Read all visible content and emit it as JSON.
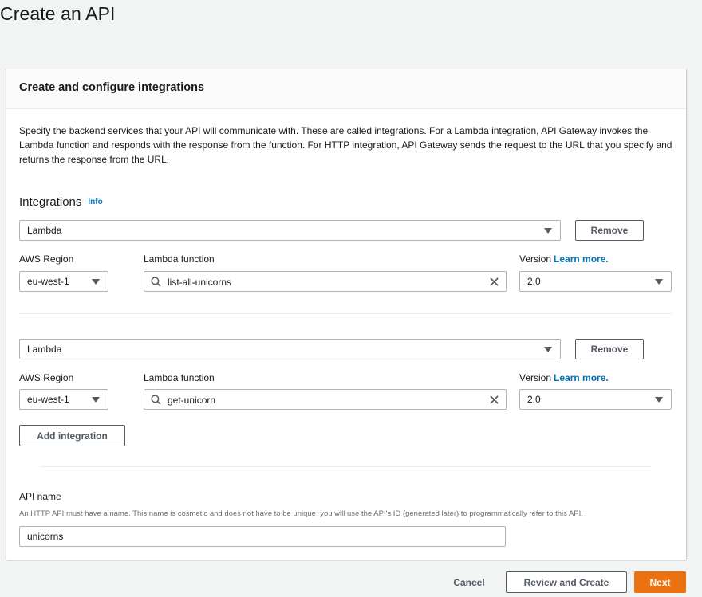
{
  "page": {
    "title": "Create an API"
  },
  "panel": {
    "title": "Create and configure integrations",
    "description": "Specify the backend services that your API will communicate with. These are called integrations. For a Lambda integration, API Gateway invokes the Lambda function and responds with the response from the function. For HTTP integration, API Gateway sends the request to the URL that you specify and returns the response from the URL."
  },
  "integrations": {
    "label": "Integrations",
    "info": "Info",
    "items": [
      {
        "type": "Lambda",
        "remove_label": "Remove",
        "region_label": "AWS Region",
        "region_value": "eu-west-1",
        "function_label": "Lambda function",
        "function_value": "list-all-unicorns",
        "version_label": "Version",
        "version_link": "Learn more.",
        "version_value": "2.0"
      },
      {
        "type": "Lambda",
        "remove_label": "Remove",
        "region_label": "AWS Region",
        "region_value": "eu-west-1",
        "function_label": "Lambda function",
        "function_value": "get-unicorn",
        "version_label": "Version",
        "version_link": "Learn more.",
        "version_value": "2.0"
      }
    ],
    "add_label": "Add integration"
  },
  "api_name": {
    "label": "API name",
    "hint": "An HTTP API must have a name. This name is cosmetic and does not have to be unique; you will use the API's ID (generated later) to programmatically refer to this API.",
    "value": "unicorns"
  },
  "footer": {
    "cancel": "Cancel",
    "review": "Review and Create",
    "next": "Next"
  },
  "colors": {
    "accent": "#ec7211",
    "link": "#0073bb"
  },
  "icons": [
    "search-icon",
    "clear-icon",
    "caret-down-icon"
  ]
}
